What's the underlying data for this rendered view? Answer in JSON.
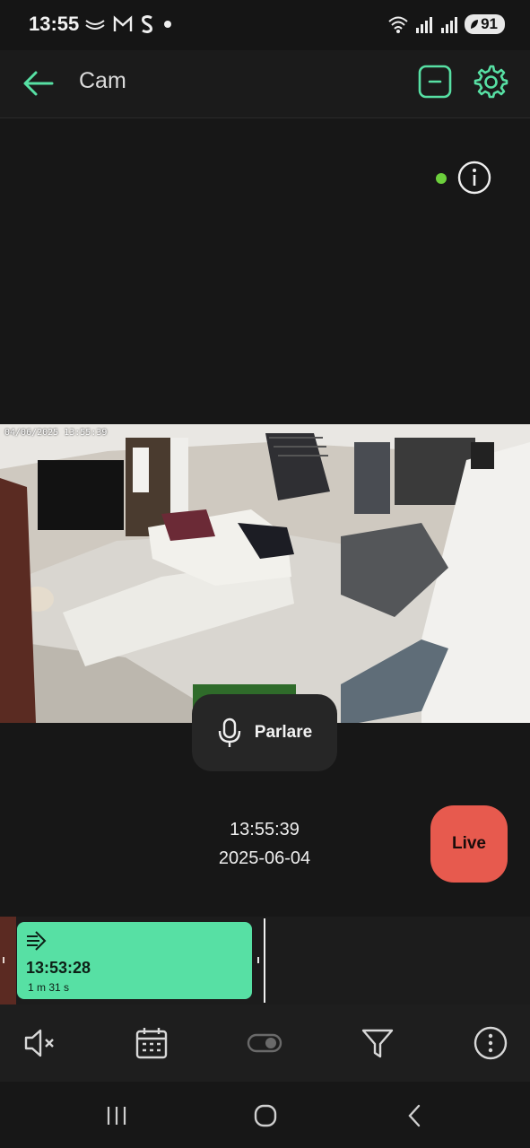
{
  "status_bar": {
    "time": "13:55",
    "battery": "91",
    "left_icons": [
      "wave-icon",
      "gmail-icon",
      "s-app-icon",
      "dot-icon"
    ],
    "right_icons": [
      "wifi-icon",
      "signal-icon",
      "signal-icon",
      "battery-icon"
    ]
  },
  "app_bar": {
    "title": "Cam"
  },
  "video": {
    "overlay_timestamp": "04/06/2025 13:55:39",
    "online": true
  },
  "talk": {
    "label": "Parlare"
  },
  "playback": {
    "time": "13:55:39",
    "date": "2025-06-04",
    "live_label": "Live"
  },
  "timeline": {
    "clip_time": "13:53:28",
    "clip_duration": "1 m 31 s"
  },
  "colors": {
    "accent": "#57e0a4",
    "live": "#e75a4e",
    "online": "#6ccf3c"
  }
}
